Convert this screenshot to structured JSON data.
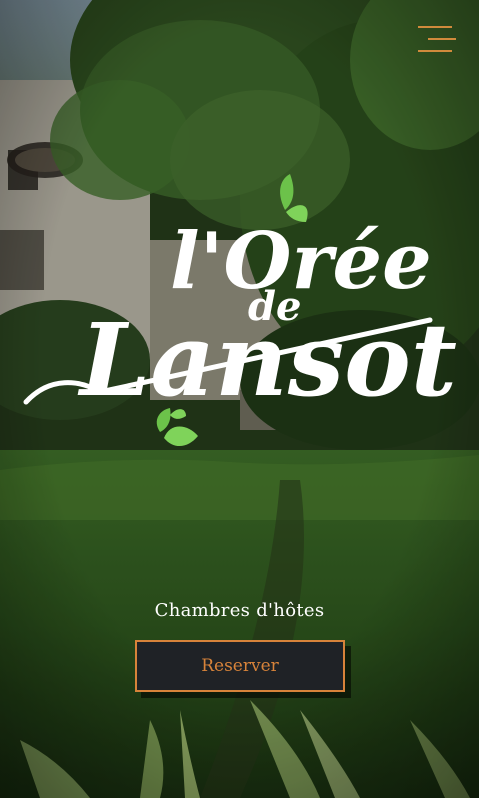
{
  "hero": {
    "logo_line1": "l'Orée",
    "logo_line2": "de",
    "logo_line3": "Lansot",
    "tagline": "Chambres d'hôtes",
    "reserve_label": "Reserver"
  },
  "header": {
    "menu_icon": "hamburger-menu-icon"
  },
  "colors": {
    "accent": "#d7833a",
    "leaf": "#6cc24a",
    "logo_text": "#ffffff",
    "button_bg": "#1f2226"
  }
}
